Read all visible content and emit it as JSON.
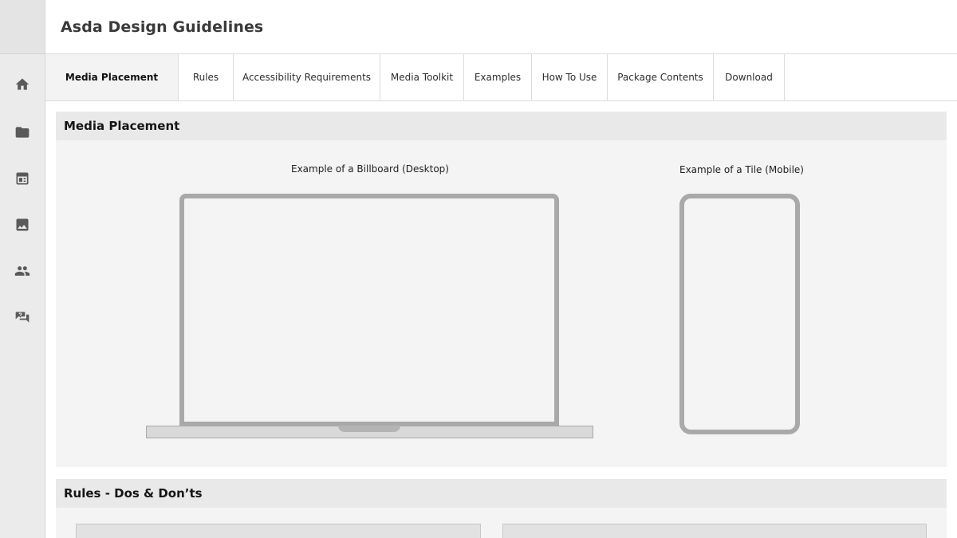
{
  "app": {
    "title": "Asda Design Guidelines"
  },
  "rail": {
    "icons": [
      "home-icon",
      "folder-icon",
      "article-icon",
      "image-icon",
      "people-icon",
      "help-chat-icon"
    ]
  },
  "tabs": [
    {
      "label": "Media Placement",
      "active": true
    },
    {
      "label": "Rules",
      "active": false
    },
    {
      "label": "Accessibility Requirements",
      "active": false
    },
    {
      "label": "Media Toolkit",
      "active": false
    },
    {
      "label": "Examples",
      "active": false
    },
    {
      "label": "How To Use",
      "active": false
    },
    {
      "label": "Package Contents",
      "active": false
    },
    {
      "label": "Download",
      "active": false
    }
  ],
  "media_placement": {
    "heading": "Media Placement",
    "billboard_caption": "Example of a Billboard (Desktop)",
    "tile_caption": "Example of a Tile (Mobile)"
  },
  "rules": {
    "heading": "Rules - Dos & Don’ts"
  },
  "colors": {
    "rail_bg": "#ebebeb",
    "section_head_bg": "#e9e9e9",
    "device_frame": "#a9a9a9"
  }
}
